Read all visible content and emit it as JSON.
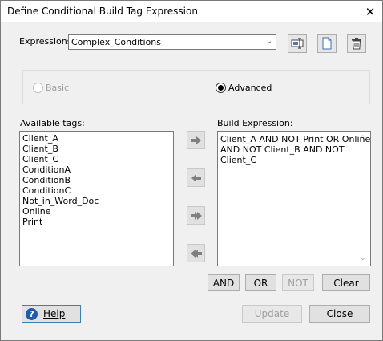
{
  "window": {
    "title": "Define Conditional Build Tag Expression"
  },
  "expressions": {
    "label": "Expressions:",
    "selected": "Complex_Conditions"
  },
  "mode": {
    "basic_label": "Basic",
    "advanced_label": "Advanced",
    "selected": "Advanced"
  },
  "available_tags": {
    "label": "Available tags:",
    "items": [
      "Client_A",
      "Client_B",
      "Client_C",
      "ConditionA",
      "ConditionB",
      "ConditionC",
      "Not_in_Word_Doc",
      "Online",
      "Print"
    ]
  },
  "build_expression": {
    "label": "Build Expression:",
    "lines": [
      "Client_A AND NOT Print OR Online",
      "AND NOT Client_B AND NOT",
      "Client_C"
    ]
  },
  "operators": {
    "and": "AND",
    "or": "OR",
    "not": "NOT",
    "clear": "Clear"
  },
  "footer": {
    "help": "Help",
    "update": "Update",
    "close": "Close"
  },
  "colors": {
    "help_blue": "#1e5ba8",
    "arrow_gray": "#7f7f7f",
    "disabled_text": "#a0a0a0"
  }
}
